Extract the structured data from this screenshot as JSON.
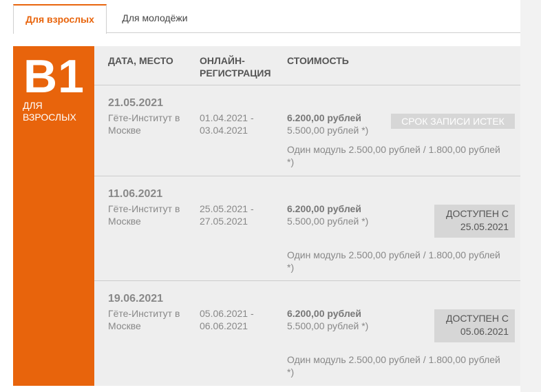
{
  "tabs": [
    {
      "label": "Для взрослых",
      "active": true
    },
    {
      "label": "Для молодёжи",
      "active": false
    }
  ],
  "level": {
    "code": "B1",
    "subtitle": "Для взрослых"
  },
  "headers": {
    "date_place": "ДАТА, МЕСТО",
    "registration": "ОНЛАЙН-РЕГИСТРАЦИЯ",
    "cost": "СТОИМОСТЬ"
  },
  "rows": [
    {
      "date": "21.05.2021",
      "place": "Гёте-Институт в Москве",
      "registration": "01.04.2021 - 03.04.2021",
      "price_main": "6.200,00 рублей",
      "price_alt": "5.500,00 рублей *)",
      "module_price": "Один модуль 2.500,00 рублей / 1.800,00 рублей *)",
      "status_label": "СРОК ЗАПИСИ ИСТЕК",
      "status_date": ""
    },
    {
      "date": "11.06.2021",
      "place": "Гёте-Институт в Москве",
      "registration": "25.05.2021 - 27.05.2021",
      "price_main": "6.200,00 рублей",
      "price_alt": "5.500,00 рублей *)",
      "module_price": "Один модуль 2.500,00 рублей / 1.800,00 рублей *)",
      "status_label": "ДОСТУПЕН С",
      "status_date": "25.05.2021"
    },
    {
      "date": "19.06.2021",
      "place": "Гёте-Институт в Москве",
      "registration": "05.06.2021 - 06.06.2021",
      "price_main": "6.200,00 рублей",
      "price_alt": "5.500,00 рублей *)",
      "module_price": "Один модуль 2.500,00 рублей / 1.800,00 рублей *)",
      "status_label": "ДОСТУПЕН С",
      "status_date": "05.06.2021"
    }
  ],
  "colors": {
    "accent": "#e8640c",
    "table_bg": "#eeeeee",
    "badge_bg": "#d6d6d6"
  }
}
